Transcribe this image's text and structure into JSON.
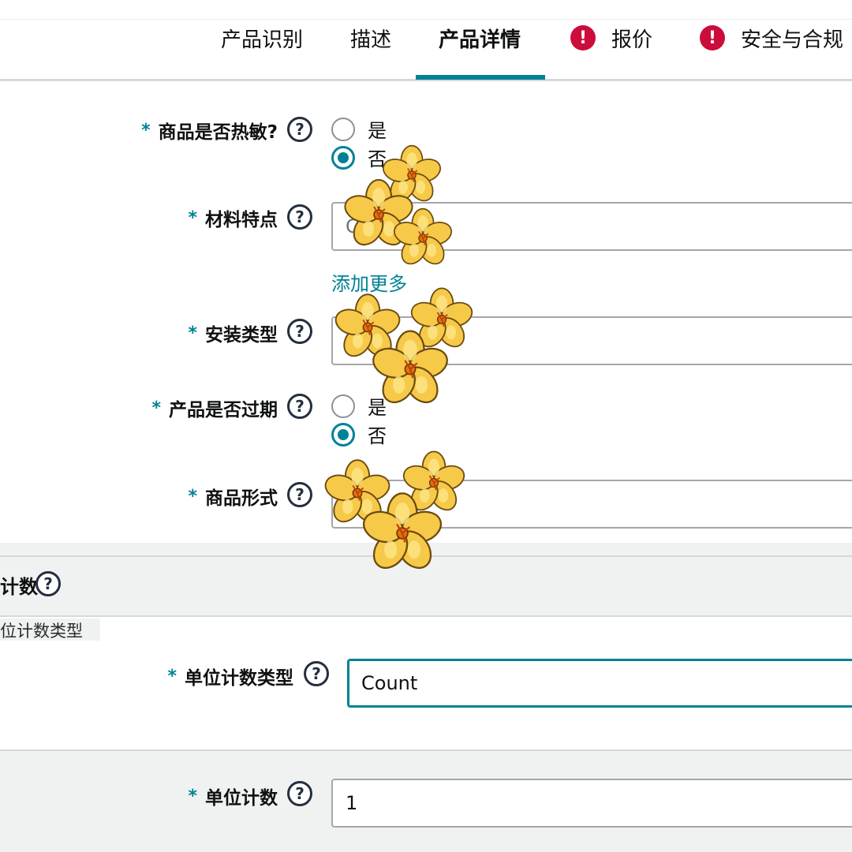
{
  "tabs": [
    {
      "label": "产品识别",
      "active": false,
      "alert": false
    },
    {
      "label": "描述",
      "active": false,
      "alert": false
    },
    {
      "label": "产品详情",
      "active": true,
      "alert": false
    },
    {
      "label": "报价",
      "active": false,
      "alert": true
    },
    {
      "label": "安全与合规",
      "active": false,
      "alert": true
    }
  ],
  "alert_glyph": "!",
  "help_glyph": "?",
  "required_mark": "*",
  "form": {
    "heat_sensitive": {
      "label": "商品是否热敏?",
      "options": [
        "是",
        "否"
      ],
      "selected": "否"
    },
    "material": {
      "label": "材料特点",
      "placeholder": "Chiffon",
      "add_more": "添加更多"
    },
    "install_type": {
      "label": "安装类型",
      "value": ""
    },
    "expiry": {
      "label": "产品是否过期",
      "options": [
        "是",
        "否"
      ],
      "selected": "否"
    },
    "item_form": {
      "label": "商品形式",
      "value": ""
    }
  },
  "unit_count_section": {
    "title": "计数",
    "subtitle": "位计数类型",
    "unit_count_type": {
      "label": "单位计数类型",
      "value": "Count"
    },
    "unit_count": {
      "label": "单位计数",
      "value": "1"
    }
  },
  "colors": {
    "accent": "#008296",
    "alert": "#cc0c39",
    "section_bg": "#f0f2f2"
  },
  "icons": [
    "alert-icon",
    "help-icon",
    "radio-icon",
    "flower-sticker"
  ]
}
